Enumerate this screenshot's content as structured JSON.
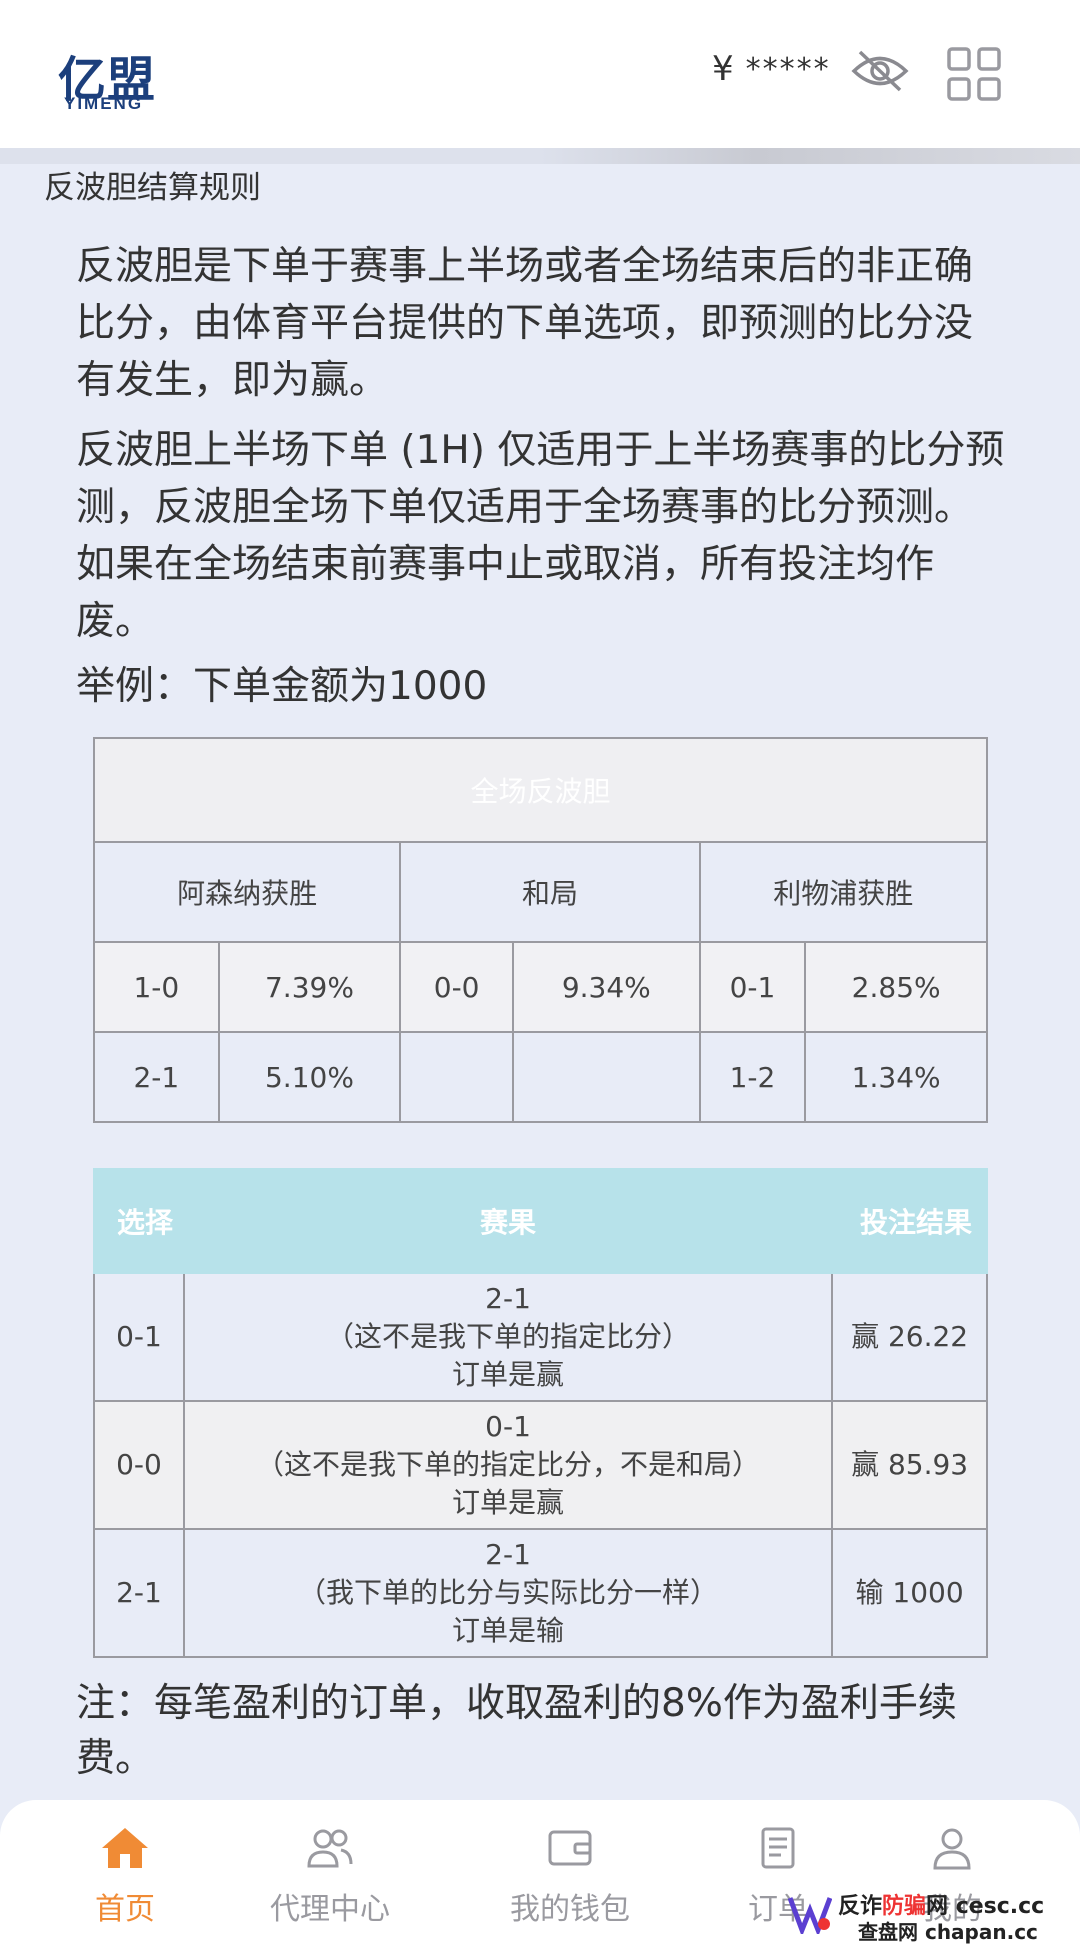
{
  "header": {
    "logo_cn": "亿盟",
    "logo_en": "YIMENG",
    "currency": "¥",
    "balance_masked": "*****"
  },
  "page": {
    "title": "反波胆结算规则"
  },
  "content": {
    "para1": "反波胆是下单于赛事上半场或者全场结束后的非正确比分，由体育平台提供的下单选项，即预测的比分没有发生，即为赢。",
    "para2": "反波胆上半场下单 (1H) 仅适用于上半场赛事的比分预测，反波胆全场下单仅适用于全场赛事的比分预测。如果在全场结束前赛事中止或取消，所有投注均作废。",
    "example": "举例：下单金额为1000",
    "note": "注：每笔盈利的订单，收取盈利的8%作为盈利手续费。"
  },
  "odds_table": {
    "title": "全场反波胆",
    "columns": [
      "阿森纳获胜",
      "和局",
      "利物浦获胜"
    ],
    "rows": [
      [
        "1-0",
        "7.39%",
        "0-0",
        "9.34%",
        "0-1",
        "2.85%"
      ],
      [
        "2-1",
        "5.10%",
        "",
        "",
        "1-2",
        "1.34%"
      ]
    ]
  },
  "result_table": {
    "headers": [
      "选择",
      "赛果",
      "投注结果"
    ],
    "rows": [
      {
        "pick": "0-1",
        "score": "2-1",
        "explain": "（这不是我下单的指定比分）",
        "verdict": "订单是赢",
        "outcome": "赢 26.22"
      },
      {
        "pick": "0-0",
        "score": "0-1",
        "explain": "（这不是我下单的指定比分，不是和局）",
        "verdict": "订单是赢",
        "outcome": "赢 85.93"
      },
      {
        "pick": "2-1",
        "score": "2-1",
        "explain": "（我下单的比分与实际比分一样）",
        "verdict": "订单是输",
        "outcome": "输 1000"
      }
    ]
  },
  "tabbar": {
    "items": [
      {
        "label": "首页",
        "icon": "home-icon",
        "active": true
      },
      {
        "label": "代理中心",
        "icon": "users-icon",
        "active": false
      },
      {
        "label": "我的钱包",
        "icon": "wallet-icon",
        "active": false
      },
      {
        "label": "订单",
        "icon": "orders-icon",
        "active": false
      },
      {
        "label": "我的",
        "icon": "user-icon",
        "active": false
      }
    ],
    "active_color": "#f08b35",
    "inactive_color": "#9a9aa0"
  },
  "watermark": {
    "line1_a": "反诈",
    "line1_b": "防骗",
    "line1_c": "网 cesc.cc",
    "line2": "查盘网 chapan.cc"
  }
}
